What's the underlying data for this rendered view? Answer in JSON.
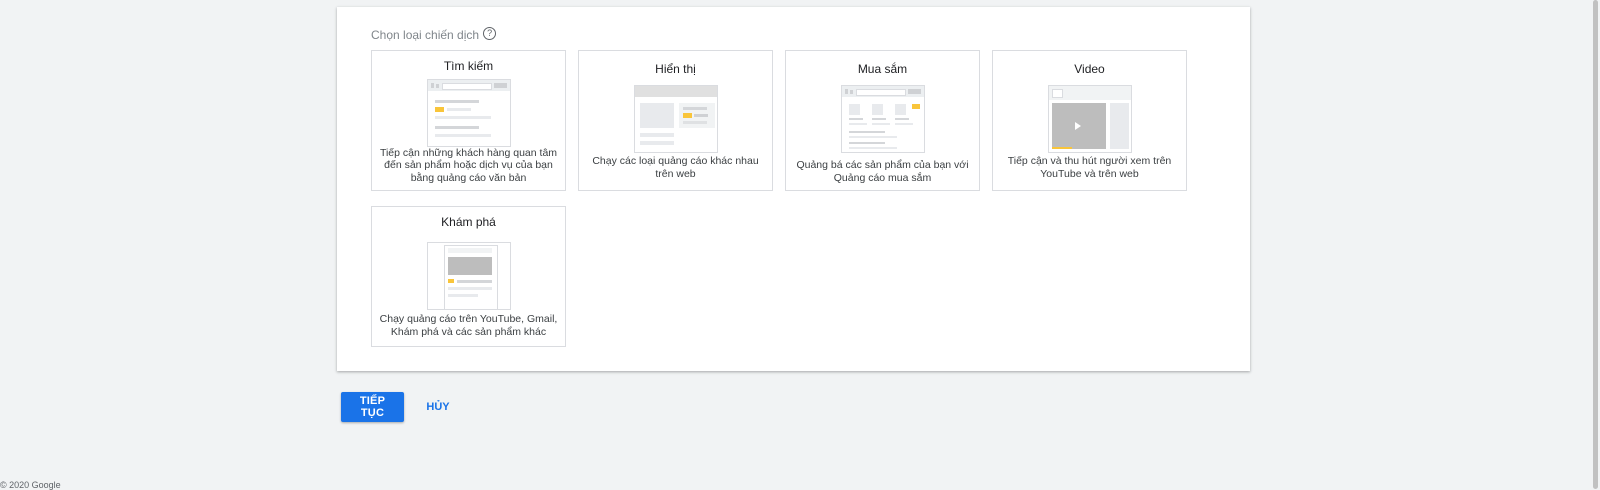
{
  "panel": {
    "title": "Chọn loại chiến dịch",
    "help_icon": "?"
  },
  "cards": [
    {
      "title": "Tìm kiếm",
      "desc": "Tiếp cận những khách hàng quan tâm đến sản phẩm hoặc dịch vụ của bạn bằng quảng cáo văn bản"
    },
    {
      "title": "Hiển thị",
      "desc": "Chạy các loại quảng cáo khác nhau trên web"
    },
    {
      "title": "Mua sắm",
      "desc": "Quảng bá các sản phẩm của bạn với Quảng cáo mua sắm"
    },
    {
      "title": "Video",
      "desc": "Tiếp cận và thu hút người xem trên YouTube và trên web"
    },
    {
      "title": "Khám phá",
      "desc": "Chạy quảng cáo trên YouTube, Gmail, Khám phá và các sản phẩm khác"
    }
  ],
  "actions": {
    "continue_label": "TIẾP TỤC",
    "cancel_label": "HỦY"
  },
  "footer": {
    "copyright": "© 2020 Google"
  },
  "colors": {
    "accent": "#1a73e8",
    "highlight": "#f9c53a"
  }
}
